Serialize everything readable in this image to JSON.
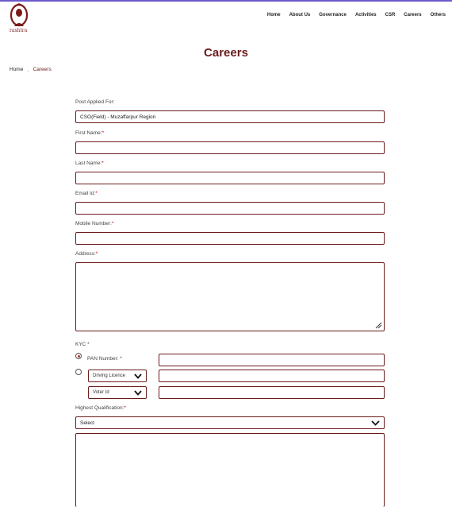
{
  "header": {
    "logo_text": "rashtra",
    "nav": [
      "Home",
      "About Us",
      "Governance",
      "Activities",
      "CSR",
      "Careers",
      "Others"
    ]
  },
  "page": {
    "title": "Careers",
    "breadcrumb": {
      "home": "Home",
      "separator": ".",
      "current": "Careers"
    }
  },
  "form": {
    "post_label": "Post Applied For:",
    "post_value": "CSO(Field) - Muzaffarpur Region",
    "first_name_label": "First Name:",
    "last_name_label": "Last Name:",
    "email_label": "Email Id:",
    "mobile_label": "Mobile Number:",
    "address_label": "Address:",
    "required_mark": "*",
    "kyc_label": "KYC *",
    "pan_label": "PAN Number: *",
    "driving_option": "Driving Licence",
    "voter_option": "Voter Id",
    "qualification_label": "Highest Qualification:",
    "qualification_value": "Select"
  },
  "colors": {
    "accent": "#6b1c1c",
    "topline": "#6a5acd",
    "required": "#cc0000"
  }
}
